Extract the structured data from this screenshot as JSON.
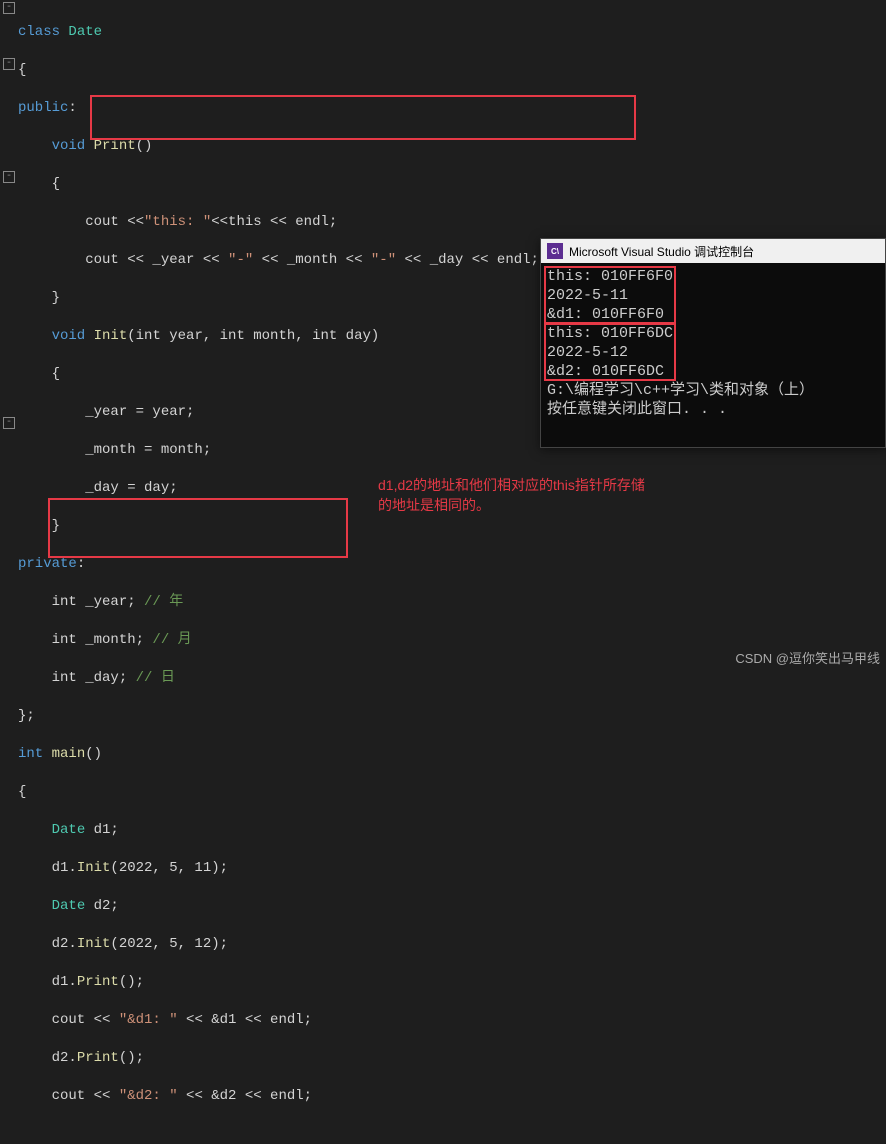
{
  "code": {
    "l1": "class Date",
    "l2": "{",
    "l3": "public:",
    "l4_a": "    void ",
    "l4_b": "Print",
    "l4_c": "()",
    "l5": "    {",
    "l6_a": "        cout <<",
    "l6_s": "\"this: \"",
    "l6_b": "<<this << endl;",
    "l7_a": "        cout << _year << ",
    "l7_s1": "\"-\"",
    "l7_b": " << _month << ",
    "l7_s2": "\"-\"",
    "l7_c": " << _day << endl;",
    "l8": "    }",
    "l9_a": "    void ",
    "l9_b": "Init",
    "l9_c": "(int year, int month, int day)",
    "l10": "    {",
    "l11": "        _year = year;",
    "l12": "        _month = month;",
    "l13": "        _day = day;",
    "l14": "    }",
    "l15": "private:",
    "l16_a": "    int _year; ",
    "l16_c": "// 年",
    "l17_a": "    int _month; ",
    "l17_c": "// 月",
    "l18_a": "    int _day; ",
    "l18_c": "// 日",
    "l19": "};",
    "l20_a": "int ",
    "l20_b": "main",
    "l20_c": "()",
    "l21": "{",
    "l22": "    Date d1;",
    "l23_a": "    d1.",
    "l23_b": "Init",
    "l23_c": "(2022, 5, 11);",
    "l24": "    Date d2;",
    "l25_a": "    d2.",
    "l25_b": "Init",
    "l25_c": "(2022, 5, 12);",
    "l26_a": "    d1.",
    "l26_b": "Print",
    "l26_c": "();",
    "l27_a": "    cout << ",
    "l27_s": "\"&d1: \"",
    "l27_b": " << &d1 << endl;",
    "l28_a": "    d2.",
    "l28_b": "Print",
    "l28_c": "();",
    "l29_a": "    cout << ",
    "l29_s": "\"&d2: \"",
    "l29_b": " << &d2 << endl;"
  },
  "console": {
    "title": "Microsoft Visual Studio 调试控制台",
    "lines": [
      "this: 010FF6F0",
      "2022-5-11",
      "&d1: 010FF6F0",
      "this: 010FF6DC",
      "2022-5-12",
      "&d2: 010FF6DC",
      "",
      "G:\\编程学习\\c++学习\\类和对象（上）",
      "按任意键关闭此窗口. . ."
    ]
  },
  "annotation": {
    "line1": "d1,d2的地址和他们相对应的this指针所存储",
    "line2": "的地址是相同的。"
  },
  "watermark": "CSDN @逗你笑出马甲线"
}
